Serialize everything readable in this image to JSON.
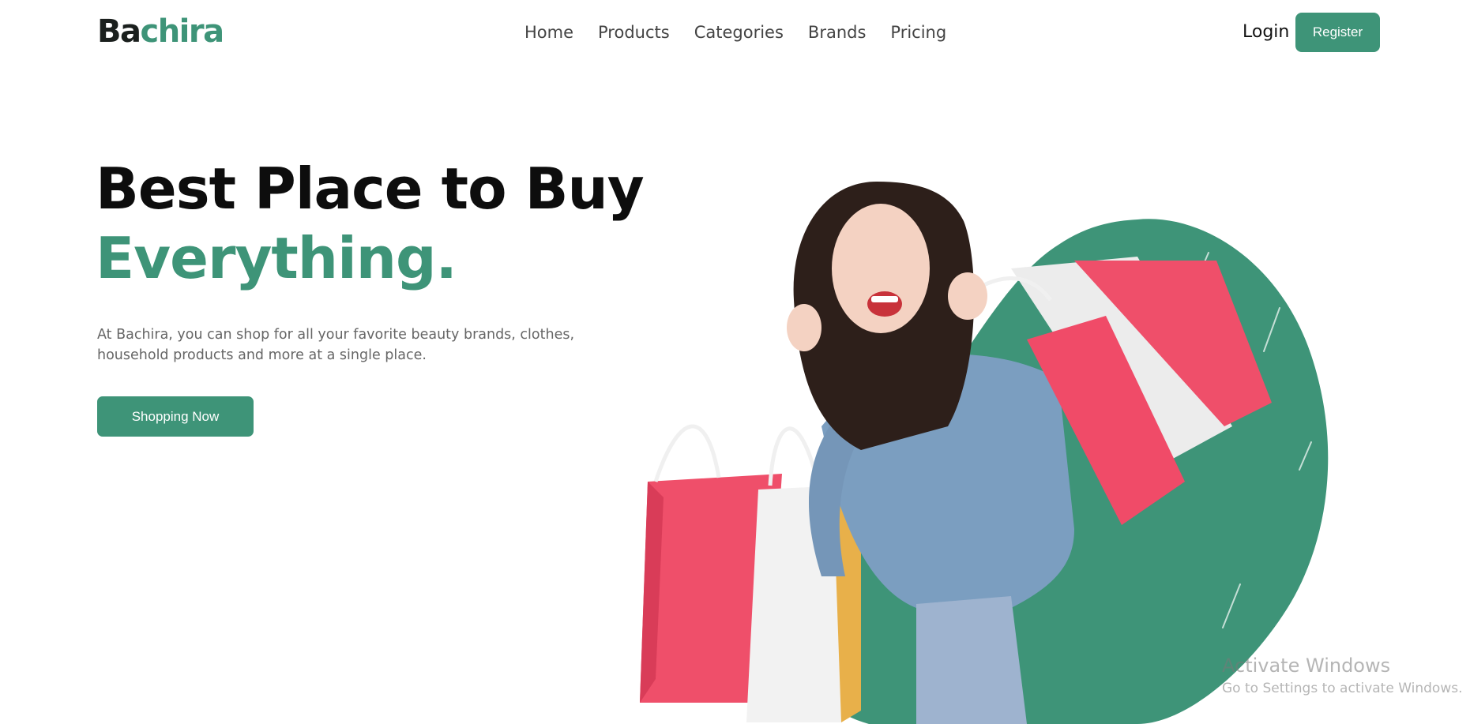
{
  "brand": {
    "logo_part1": "Ba",
    "logo_part2": "chira",
    "accent_color": "#3e9478"
  },
  "nav": {
    "items": [
      {
        "label": "Home"
      },
      {
        "label": "Products"
      },
      {
        "label": "Categories"
      },
      {
        "label": "Brands"
      },
      {
        "label": "Pricing"
      }
    ],
    "login_label": "Login",
    "register_label": "Register"
  },
  "hero": {
    "title_line1": "Best Place to Buy",
    "title_line2": "Everything.",
    "description": "At Bachira, you can shop for all your favorite beauty brands, clothes, household products and more at a single place.",
    "cta_label": "Shopping Now",
    "image_description_icon": "woman-with-shopping-bags-image"
  },
  "watermark": {
    "title": "Activate Windows",
    "subtitle": "Go to Settings to activate Windows."
  }
}
